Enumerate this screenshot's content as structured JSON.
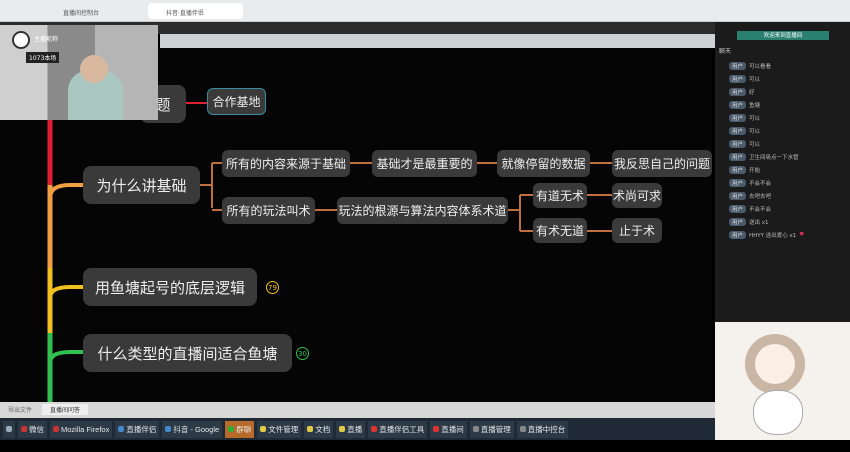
{
  "browser": {
    "tabs": [
      "直播间控制台",
      "抖音·直播伴侣"
    ]
  },
  "streamer": {
    "name": "主播昵称",
    "stats": "1073本场"
  },
  "mindmap": {
    "root": "题",
    "root_child": "合作基地",
    "branches": [
      {
        "label": "为什么讲基础",
        "color": "#f0a040"
      },
      {
        "label": "用鱼塘起号的底层逻辑",
        "badge": "79",
        "color": "#f0c020"
      },
      {
        "label": "什么类型的直播间适合鱼塘",
        "badge": "30",
        "color": "#30c050"
      }
    ],
    "sub": {
      "a": "所有的内容来源于基础",
      "a1": "基础才是最重要的",
      "a2": "就像停留的数据",
      "a3": "我反思自己的问题",
      "b": "所有的玩法叫术",
      "b1": "玩法的根源与算法内容体系术道",
      "b2": "有道无术",
      "b3": "有术无道",
      "b2a": "术尚可求",
      "b3a": "止于术"
    },
    "spine_colors": [
      "#e02030",
      "#f0a040",
      "#f0c020",
      "#30c050"
    ]
  },
  "chat": {
    "banner": "欢迎来到直播间",
    "header": "聊天",
    "messages": [
      {
        "lv": "用户",
        "text": "可以看看"
      },
      {
        "lv": "用户",
        "text": "可以"
      },
      {
        "lv": "用户",
        "text": "好"
      },
      {
        "lv": "用户",
        "text": "鱼塘"
      },
      {
        "lv": "用户",
        "text": "可以"
      },
      {
        "lv": "用户",
        "text": "可以"
      },
      {
        "lv": "用户",
        "text": "可以"
      },
      {
        "lv": "用户",
        "text": "卫生间吸点一下水管"
      },
      {
        "lv": "用户",
        "text": "开始"
      },
      {
        "lv": "用户",
        "text": "不会不会"
      },
      {
        "lv": "用户",
        "text": "去吧去吧"
      },
      {
        "lv": "用户",
        "text": "不会不会"
      },
      {
        "lv": "用户",
        "text": "送出 x1"
      },
      {
        "lv": "用户",
        "text": "HHYY 送出爱心 x1"
      }
    ]
  },
  "bottom_tabs": [
    "导出文件",
    "直播间问答"
  ],
  "taskbar": [
    "微信",
    "Mozilla Firefox",
    "直播伴侣",
    "抖音 - Google",
    "群聊",
    "文件管理",
    "文档",
    "直播",
    "直播伴侣工具",
    "直播间",
    "直播管理",
    "直播中控台"
  ]
}
